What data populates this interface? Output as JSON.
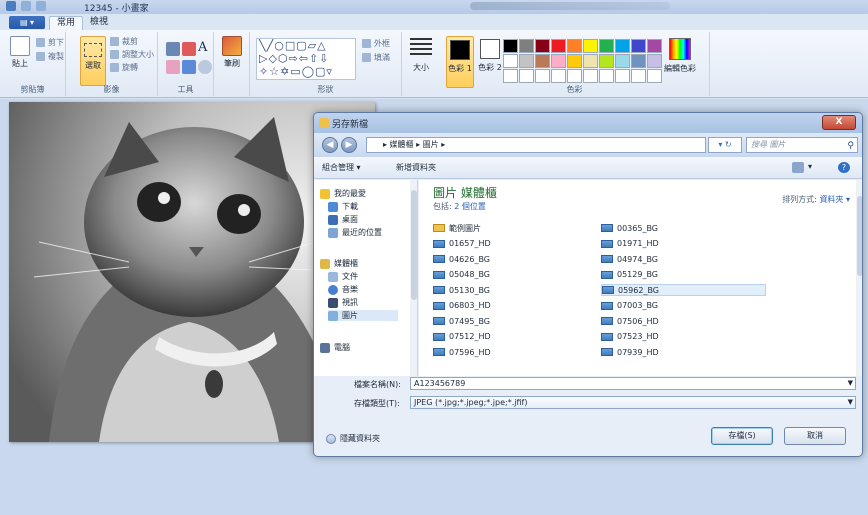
{
  "window": {
    "title": "12345 - 小畫家"
  },
  "ribbon": {
    "file_button": "▤ ▾",
    "tabs": [
      {
        "label": "常用"
      },
      {
        "label": "檢視"
      }
    ],
    "clipboard": {
      "paste": "貼上",
      "cut": "剪下",
      "copy": "複製",
      "label": "剪貼簿"
    },
    "image": {
      "select": "選取",
      "crop": "裁剪",
      "resize": "調整大小",
      "rotate": "旋轉",
      "label": "影像"
    },
    "tools": {
      "label": "工具",
      "text_tool": "A"
    },
    "brushes": {
      "label": "筆刷"
    },
    "shapes": {
      "glyphs_row1": "╲╱○□▢▱△",
      "glyphs_row2": "▷◇⬡⇨⇦⇧⇩",
      "glyphs_row3": "✧☆✡▭◯▢▿",
      "outline": "外框",
      "fill": "填滿",
      "label": "形狀"
    },
    "size": {
      "label": "大小"
    },
    "colors": {
      "color1": "色彩 1",
      "color2": "色彩 2",
      "edit": "編輯色彩",
      "label": "色彩",
      "color1_value": "#000000",
      "color2_value": "#ffffff",
      "palette": [
        "#000000",
        "#7f7f7f",
        "#880015",
        "#ed1c24",
        "#ff7f27",
        "#fff200",
        "#22b14c",
        "#00a2e8",
        "#3f48cc",
        "#a349a4",
        "#ffffff",
        "#c3c3c3",
        "#b97a57",
        "#ffaec9",
        "#ffc90e",
        "#efe4b0",
        "#b5e61d",
        "#99d9ea",
        "#7092be",
        "#c8bfe7",
        "#ffffff",
        "#ffffff",
        "#ffffff",
        "#ffffff",
        "#ffffff",
        "#ffffff",
        "#ffffff",
        "#ffffff",
        "#ffffff",
        "#ffffff"
      ]
    }
  },
  "dialog": {
    "title": "另存新檔",
    "close": "X",
    "back": "◀",
    "forward": "▶",
    "address": "▸ 媒體櫃 ▸ 圖片 ▸",
    "refresh": "▾ ↻",
    "search_placeholder": "搜尋 圖片",
    "search_icon": "⚲",
    "toolbar": {
      "organize": "組合管理 ▾",
      "new_folder": "新增資料夾",
      "view": "▾",
      "help": "?"
    },
    "nav": {
      "favorites": "我的最愛",
      "downloads": "下載",
      "desktop": "桌面",
      "recent": "最近的位置",
      "libraries": "媒體櫃",
      "documents": "文件",
      "music": "音樂",
      "videos": "視訊",
      "pictures": "圖片",
      "computer": "電腦"
    },
    "library": {
      "title": "圖片 媒體櫃",
      "includes": "包括:",
      "locations": "2 個位置",
      "arrange_by": "排列方式:",
      "arrange_value": "資料夾 ▾"
    },
    "files_left": [
      "範例圖片",
      "01657_HD",
      "04626_BG",
      "05048_BG",
      "05130_BG",
      "06803_HD",
      "07495_BG",
      "07512_HD",
      "07596_HD"
    ],
    "files_right": [
      "00365_BG",
      "01971_HD",
      "04974_BG",
      "05129_BG",
      "05962_BG",
      "07003_BG",
      "07506_HD",
      "07523_HD",
      "07939_HD"
    ],
    "filename_label": "檔案名稱(N):",
    "filename_value": "A123456789",
    "filetype_label": "存檔類型(T):",
    "filetype_value": "JPEG (*.jpg;*.jpeg;*.jpe;*.jfif)",
    "hide_folders": "隱藏資料夾",
    "save": "存檔(S)",
    "cancel": "取消"
  }
}
